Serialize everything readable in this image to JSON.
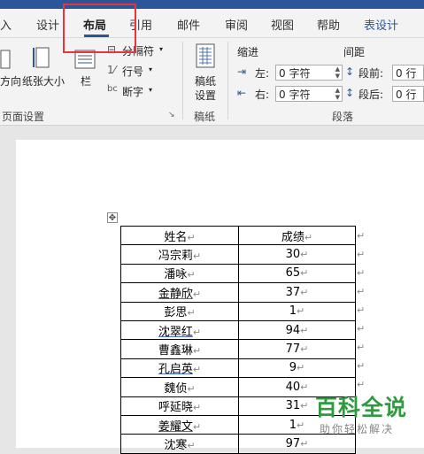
{
  "ribbon_tabs": [
    {
      "label": "入"
    },
    {
      "label": "设计"
    },
    {
      "label": "布局"
    },
    {
      "label": "引用"
    },
    {
      "label": "邮件"
    },
    {
      "label": "审阅"
    },
    {
      "label": "视图"
    },
    {
      "label": "帮助"
    },
    {
      "label": "表设计"
    }
  ],
  "page_setup": {
    "orientation_label": "方向",
    "size_label": "纸张大小",
    "columns_label": "栏",
    "breaks_label": "分隔符",
    "line_numbers_label": "行号",
    "hyphenation_label": "断字",
    "group_label": "页面设置"
  },
  "manuscript": {
    "button_label_line1": "稿纸",
    "button_label_line2": "设置",
    "group_label": "稿纸"
  },
  "paragraph": {
    "indent_title": "缩进",
    "spacing_title": "间距",
    "left_label": "左:",
    "right_label": "右:",
    "before_label": "段前:",
    "after_label": "段后:",
    "left_value": "0 字符",
    "right_value": "0 字符",
    "before_value": "0 行",
    "after_value": "0 行",
    "group_label": "段落"
  },
  "table": {
    "headers": [
      "姓名",
      "成绩"
    ],
    "rows": [
      {
        "name": "冯宗莉",
        "score": "30"
      },
      {
        "name": "潘咏",
        "score": "65"
      },
      {
        "name": "金静欣",
        "score": "37"
      },
      {
        "name": "彭思",
        "score": "1"
      },
      {
        "name": "沈翠红",
        "score": "94"
      },
      {
        "name": "曹鑫琳",
        "score": "77"
      },
      {
        "name": "孔启英",
        "score": "9"
      },
      {
        "name": "魏侦",
        "score": "40"
      },
      {
        "name": "呼延晓",
        "score": "31"
      },
      {
        "name": "姜耀文",
        "score": "1"
      },
      {
        "name": "沈寒",
        "score": "97"
      }
    ]
  },
  "watermark": {
    "title": "百科全说",
    "subtitle": "助你轻松解决"
  },
  "colors": {
    "accent": "#2b579a",
    "highlight": "#e8353b",
    "watermark": "#2e9b3e"
  }
}
